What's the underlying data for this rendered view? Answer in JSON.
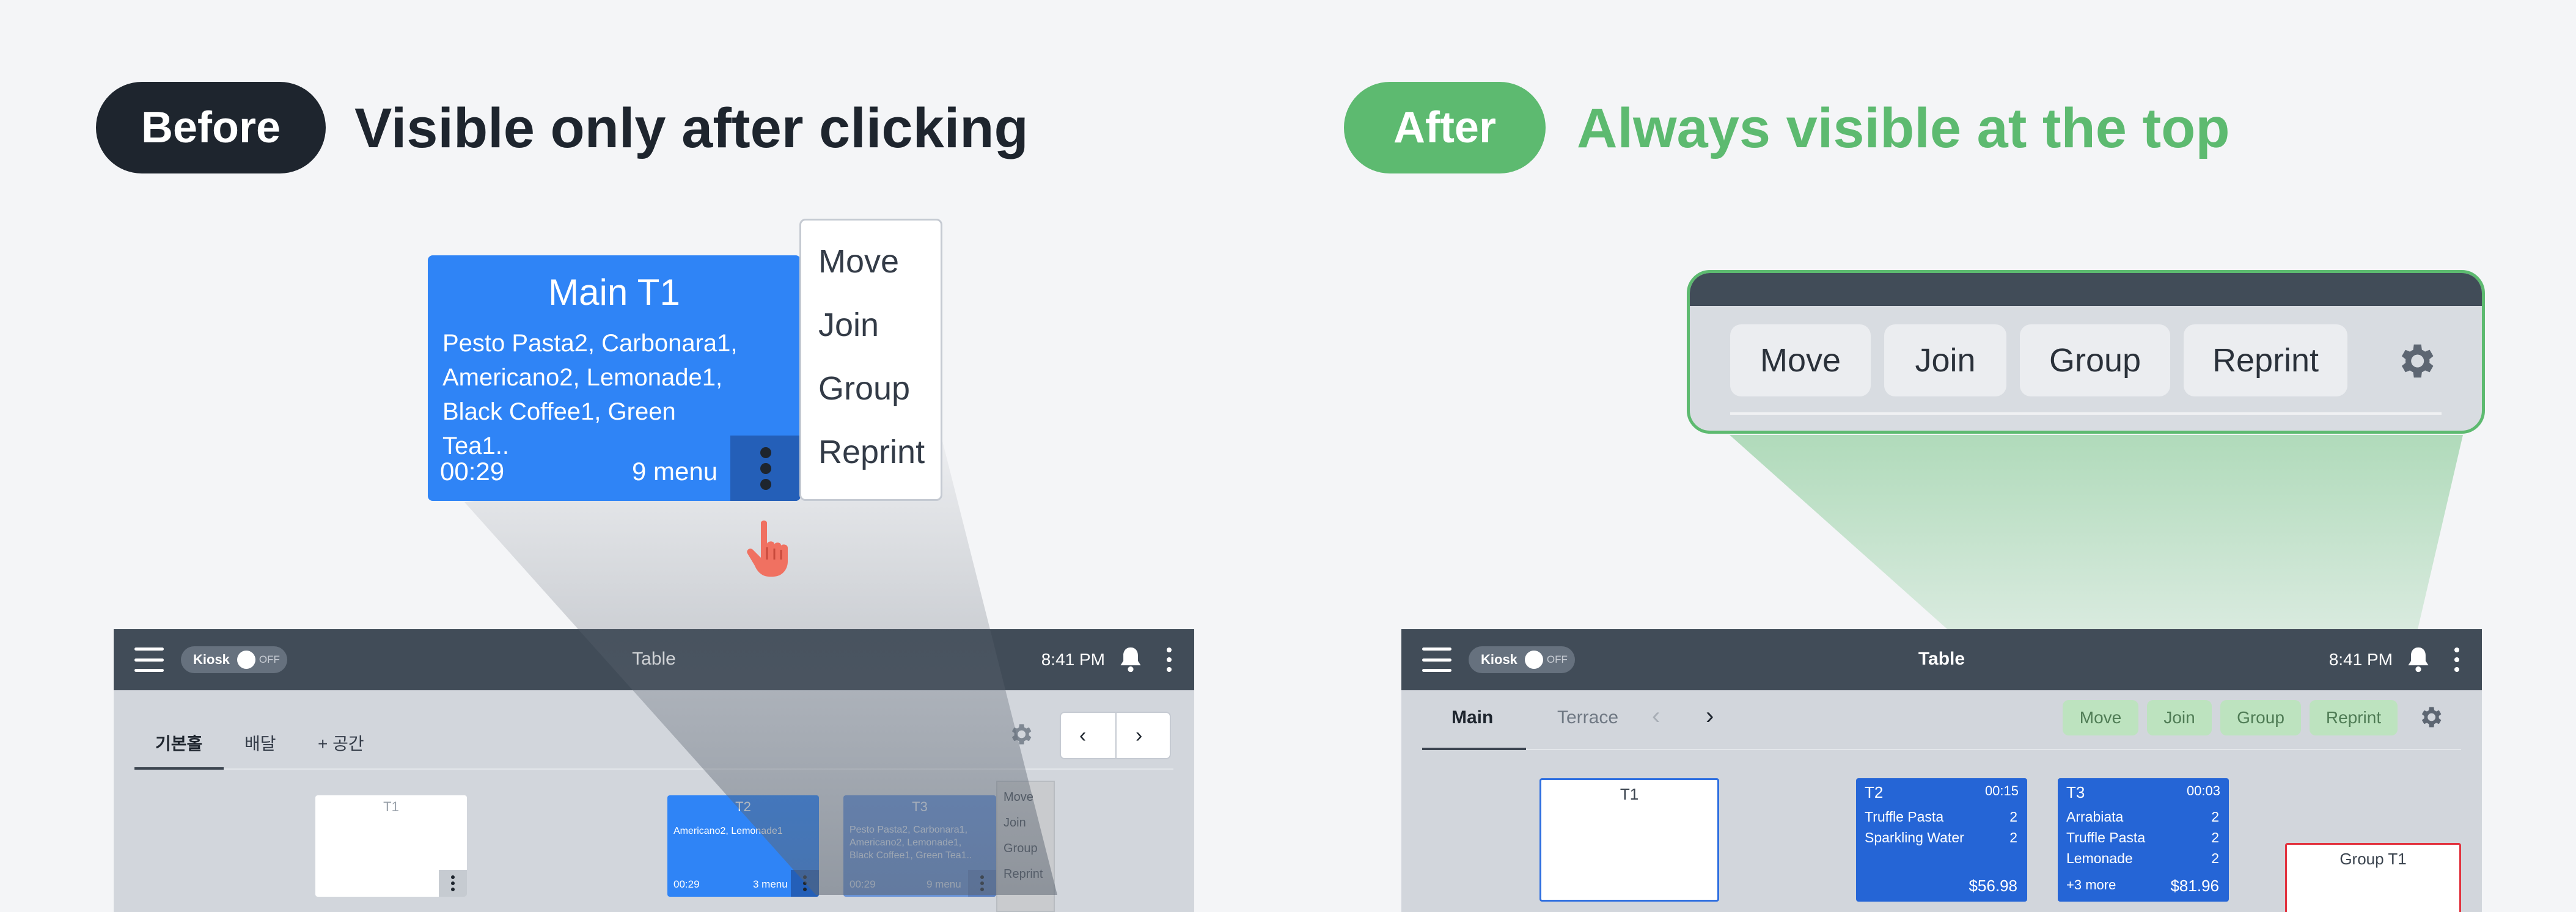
{
  "before": {
    "badge": "Before",
    "headline": "Visible only after clicking",
    "zoom_card": {
      "title": "Main T1",
      "items_line1": "Pesto Pasta2, Carbonara1,",
      "items_line2": "Americano2, Lemonade1,",
      "items_line3": "Black Coffee1, Green Tea1..",
      "time": "00:29",
      "count": "9 menu"
    },
    "zoom_menu": [
      "Move",
      "Join",
      "Group",
      "Reprint"
    ],
    "app": {
      "kiosk_label": "Kiosk",
      "kiosk_state": "OFF",
      "title": "Table",
      "time": "8:41 PM",
      "tabs": [
        "기본홀",
        "배달",
        "+ 공간"
      ],
      "nav_prev": "‹",
      "nav_next": "›",
      "t1": {
        "title": "T1"
      },
      "t2": {
        "title": "T2",
        "items": "Americano2, Lemonade1",
        "time": "00:29",
        "count": "3 menu"
      },
      "t3": {
        "title": "T3",
        "items_line1": "Pesto Pasta2, Carbonara1,",
        "items_line2": "Americano2, Lemonade1,",
        "items_line3": "Black Coffee1, Green Tea1..",
        "time": "00:29",
        "count": "9 menu"
      },
      "menu": [
        "Move",
        "Join",
        "Group",
        "Reprint"
      ]
    }
  },
  "after": {
    "badge": "After",
    "headline": "Always visible at the top",
    "toolbar": [
      "Move",
      "Join",
      "Group",
      "Reprint"
    ],
    "app": {
      "kiosk_label": "Kiosk",
      "kiosk_state": "OFF",
      "title": "Table",
      "time": "8:41 PM",
      "tabs": [
        "Main",
        "Terrace"
      ],
      "nav_prev": "‹",
      "nav_next": "›",
      "actions": [
        "Move",
        "Join",
        "Group",
        "Reprint"
      ],
      "t1": {
        "title": "T1"
      },
      "t2": {
        "title": "T2",
        "time": "00:15",
        "rows": [
          {
            "name": "Truffle Pasta",
            "qty": "2"
          },
          {
            "name": "Sparkling Water",
            "qty": "2"
          }
        ],
        "total": "$56.98"
      },
      "t3": {
        "title": "T3",
        "time": "00:03",
        "rows": [
          {
            "name": "Arrabiata",
            "qty": "2"
          },
          {
            "name": "Truffle Pasta",
            "qty": "2"
          },
          {
            "name": "Lemonade",
            "qty": "2"
          }
        ],
        "more": "+3 more",
        "total": "$81.96"
      },
      "group": {
        "title": "Group T1"
      }
    }
  },
  "colors": {
    "dark": "#1e252e",
    "accent_green": "#5dba70",
    "card_blue": "#2f84f6",
    "card_blue_dark": "#2565d6",
    "topbar": "#414c58",
    "canvas": "#d2d6dc",
    "hand": "#f07161",
    "group_border": "#e2333f"
  },
  "icons": [
    "hamburger-icon",
    "bell-icon",
    "kebab-icon",
    "gear-icon",
    "chevron-left-icon",
    "chevron-right-icon",
    "pointing-hand-icon"
  ]
}
